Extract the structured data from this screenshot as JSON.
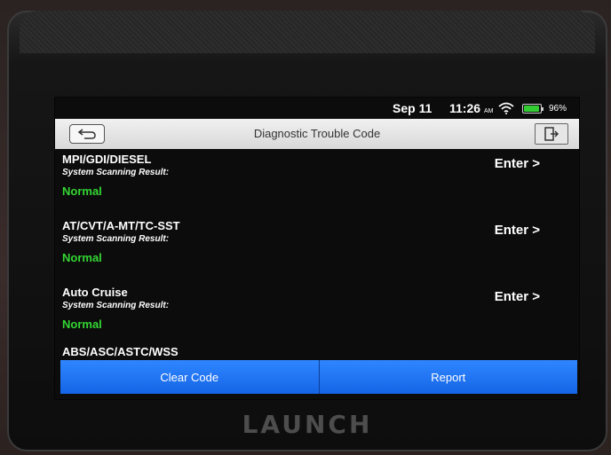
{
  "status_bar": {
    "date": "Sep 11",
    "time": "11:26",
    "ampm": "AM",
    "battery_percent": "96%",
    "battery_level": 0.96,
    "wifi_icon": "wifi-icon",
    "battery_icon": "battery-icon"
  },
  "title_bar": {
    "title": "Diagnostic Trouble Code",
    "back_icon": "back-arrow-icon",
    "exit_icon": "exit-icon"
  },
  "systems": [
    {
      "name": "MPI/GDI/DIESEL",
      "label": "System Scanning Result:",
      "status": "Normal",
      "action": "Enter >"
    },
    {
      "name": "AT/CVT/A-MT/TC-SST",
      "label": "System Scanning Result:",
      "status": "Normal",
      "action": "Enter >"
    },
    {
      "name": "Auto Cruise",
      "label": "System Scanning Result:",
      "status": "Normal",
      "action": "Enter >"
    },
    {
      "name": "ABS/ASC/ASTC/WSS",
      "label": "",
      "status": "",
      "action": ""
    }
  ],
  "actions": {
    "clear_code": "Clear Code",
    "report": "Report"
  },
  "device": {
    "brand": "LAUNCH"
  },
  "colors": {
    "status_normal": "#33d633",
    "button_blue": "#1f75f5",
    "title_bar": "#e4e4e4"
  }
}
